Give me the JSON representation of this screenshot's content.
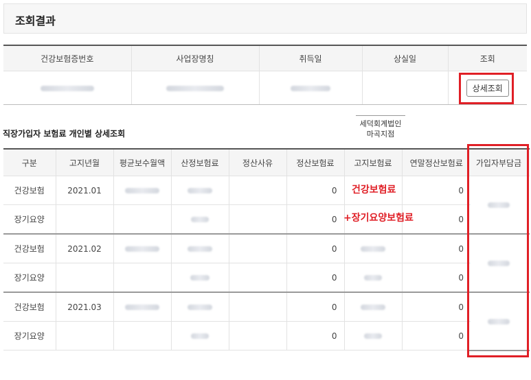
{
  "header": {
    "title": "조회결과"
  },
  "summary_table": {
    "columns": [
      "건강보험증번호",
      "사업장명칭",
      "취득일",
      "상실일",
      "조회"
    ],
    "detail_button": "상세조회"
  },
  "detail_section": {
    "title": "직장가입자 보험료 개인별 상세조회",
    "company": [
      "세덕회계법인",
      "마곡지점"
    ],
    "columns": [
      "구분",
      "고지년월",
      "평균보수월액",
      "산정보험료",
      "정산사유",
      "정산보험료",
      "고지보험료",
      "연말정산보험료",
      "가입자부담금"
    ],
    "rows": [
      {
        "type": "건강보험",
        "month": "2021.01",
        "settle": "0",
        "yearend": "0"
      },
      {
        "type": "장기요양",
        "month": "",
        "settle": "0",
        "yearend": "0"
      },
      {
        "type": "건강보험",
        "month": "2021.02",
        "settle": "0",
        "yearend": "0"
      },
      {
        "type": "장기요양",
        "month": "",
        "settle": "0",
        "yearend": "0"
      },
      {
        "type": "건강보험",
        "month": "2021.03",
        "settle": "0",
        "yearend": "0"
      },
      {
        "type": "장기요양",
        "month": "",
        "settle": "0",
        "yearend": "0"
      }
    ]
  },
  "annotations": {
    "health_premium": "건강보험료",
    "long_term_care": "+장기요양보험료"
  },
  "colors": {
    "highlight": "#e01f26"
  }
}
